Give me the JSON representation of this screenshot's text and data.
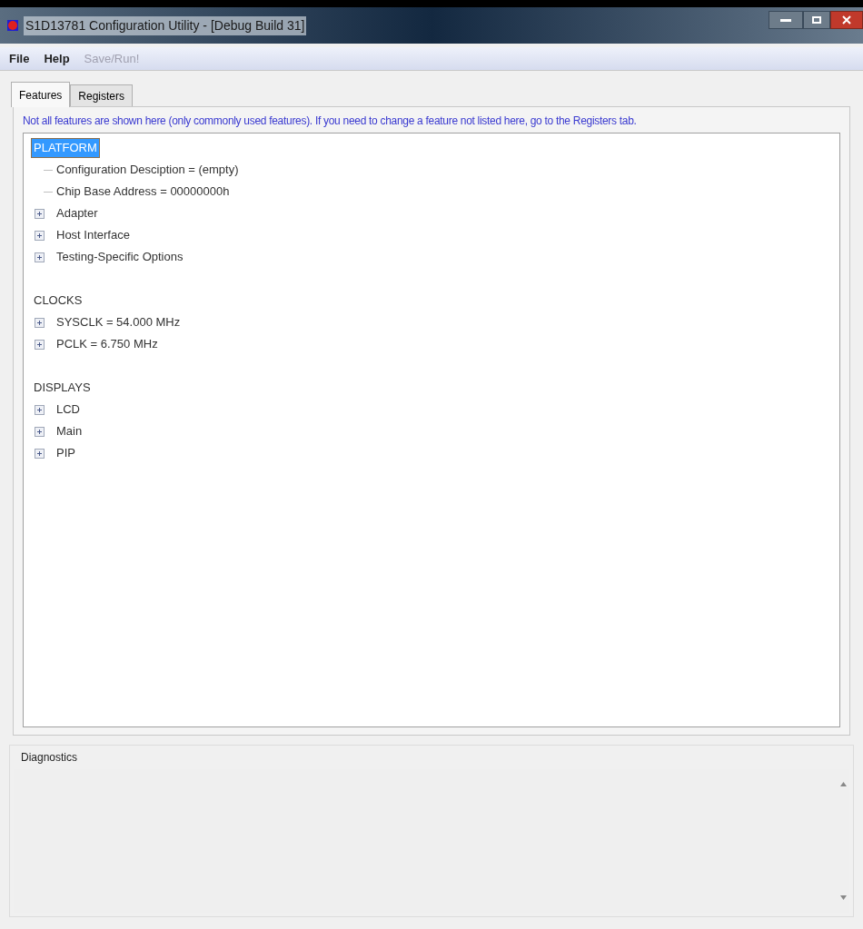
{
  "window": {
    "title": "S1D13781 Configuration Utility - [Debug Build 31]"
  },
  "menu": [
    {
      "label": "File",
      "disabled": false
    },
    {
      "label": "Help",
      "disabled": false
    },
    {
      "label": "Save/Run!",
      "disabled": true
    }
  ],
  "tabs": [
    {
      "label": "Features",
      "selected": true
    },
    {
      "label": "Registers",
      "selected": false
    }
  ],
  "notice": "Not all features are shown here (only commonly used features).  If you need to change a feature not listed here, go to the Registers tab.",
  "tree": [
    {
      "label": "PLATFORM",
      "selected": true,
      "children": [
        {
          "label": "Configuration Desciption  =  (empty)",
          "kind": "leaf"
        },
        {
          "label": "Chip Base Address  =  00000000h",
          "kind": "leaf"
        },
        {
          "label": "Adapter",
          "kind": "node",
          "expanded": false
        },
        {
          "label": "Host Interface",
          "kind": "node",
          "expanded": false
        },
        {
          "label": "Testing-Specific Options",
          "kind": "node",
          "expanded": false
        }
      ]
    },
    {
      "label": "CLOCKS",
      "selected": false,
      "children": [
        {
          "label": "SYSCLK  =  54.000 MHz",
          "kind": "node",
          "expanded": false
        },
        {
          "label": "PCLK  =  6.750 MHz",
          "kind": "node",
          "expanded": false
        }
      ]
    },
    {
      "label": "DISPLAYS",
      "selected": false,
      "children": [
        {
          "label": "LCD",
          "kind": "node",
          "expanded": false
        },
        {
          "label": "Main",
          "kind": "node",
          "expanded": false
        },
        {
          "label": "PIP",
          "kind": "node",
          "expanded": false
        }
      ]
    }
  ],
  "diagnostics": {
    "title": "Diagnostics"
  }
}
